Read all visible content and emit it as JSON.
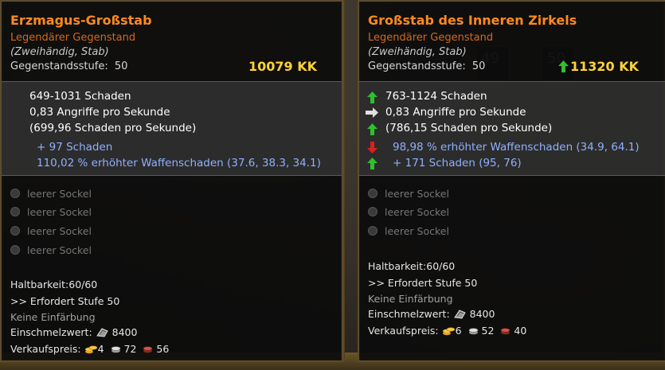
{
  "left_item": {
    "name": "Erzmagus-Großstab",
    "rarity": "Legendärer Gegenstand",
    "type": "(Zweihändig, Stab)",
    "level_label": "Gegenstandsstufe:",
    "level_value": "50",
    "price": "10079 KK",
    "stats": [
      "649-1031 Schaden",
      "0,83 Angriffe pro Sekunde",
      "(699,96 Schaden pro Sekunde)",
      "+ 97 Schaden",
      "110,02 % erhöhter Waffenschaden (37.6, 38.3, 34.1)"
    ],
    "sockets": [
      "leerer Sockel",
      "leerer Sockel",
      "leerer Sockel",
      "leerer Sockel"
    ],
    "durability": "Haltbarkeit:60/60",
    "requires": ">> Erfordert Stufe 50",
    "dye": "Keine Einfärbung",
    "salvage_label": "Einschmelzwert:",
    "salvage_value": "8400",
    "sell_label": "Verkaufspreis:",
    "sell_gold": "4",
    "sell_silver": "72",
    "sell_copper": "56"
  },
  "right_item": {
    "name": "Großstab des Inneren Zirkels",
    "rarity": "Legendärer Gegenstand",
    "type": "(Zweihändig, Stab)",
    "level_label": "Gegenstandsstufe:",
    "level_value": "50",
    "price": "11320 KK",
    "price_trend": "up",
    "stats": [
      {
        "text": "763-1124 Schaden",
        "trend": "up"
      },
      {
        "text": "0,83 Angriffe pro Sekunde",
        "trend": "same"
      },
      {
        "text": "(786,15 Schaden pro Sekunde)",
        "trend": "up"
      },
      {
        "text": "98,98 % erhöhter Waffenschaden (34.9, 64.1)",
        "trend": "down"
      },
      {
        "text": "+ 171 Schaden (95, 76)",
        "trend": "up"
      }
    ],
    "sockets": [
      "leerer Sockel",
      "leerer Sockel",
      "leerer Sockel"
    ],
    "durability": "Haltbarkeit:60/60",
    "requires": ">> Erfordert Stufe 50",
    "dye": "Keine Einfärbung",
    "salvage_label": "Einschmelzwert:",
    "salvage_value": "8400",
    "sell_label": "Verkaufspreis:",
    "sell_gold": "6",
    "sell_silver": "52",
    "sell_copper": "40"
  },
  "colors": {
    "title": "#ff8a1c",
    "price": "#ffd23a",
    "bonus_stat": "#8fb0ff",
    "arrow_up": "#2fbf2f",
    "arrow_down": "#d42222",
    "arrow_same": "#e0e0e0"
  },
  "background": {
    "slot_labels": [
      "49",
      "50"
    ]
  }
}
